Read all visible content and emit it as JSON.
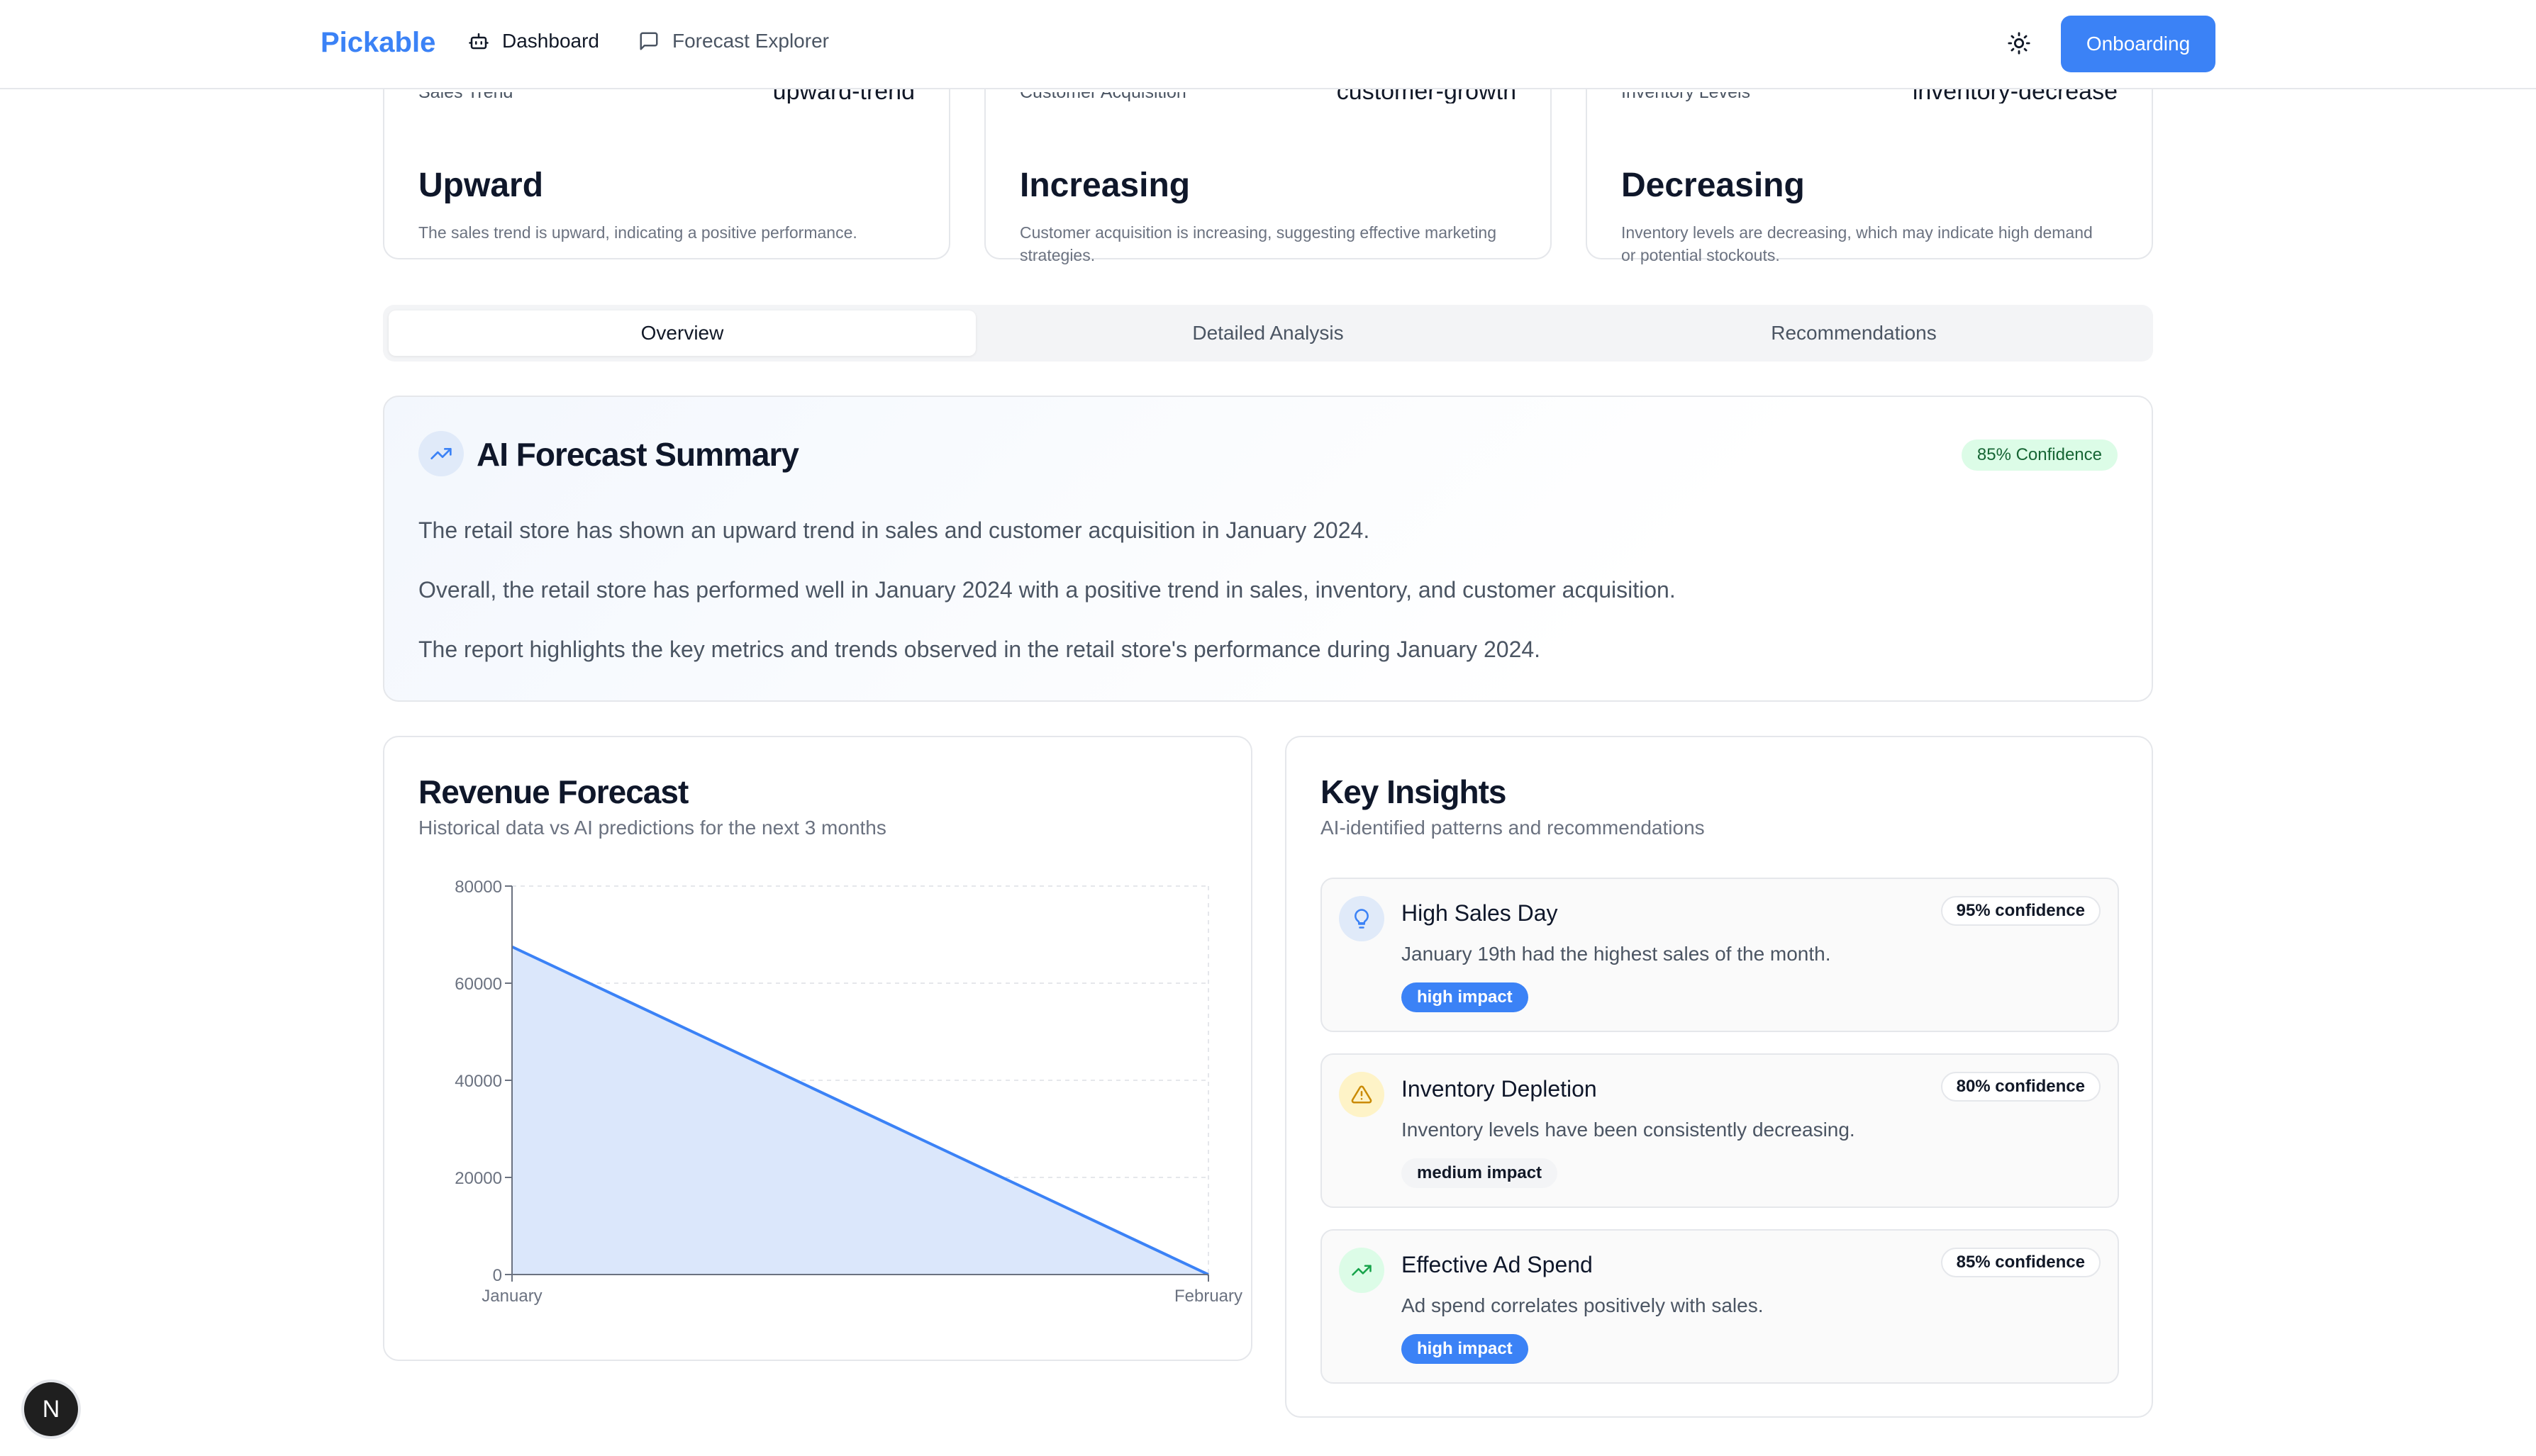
{
  "nav": {
    "brand": "Pickable",
    "links": [
      {
        "label": "Dashboard",
        "icon": "robot-icon",
        "active": true
      },
      {
        "label": "Forecast Explorer",
        "icon": "message-square-icon",
        "active": false
      }
    ],
    "theme_icon": "sun-icon",
    "onboarding_label": "Onboarding"
  },
  "stats": [
    {
      "label": "Sales Trend",
      "key": "upward-trend",
      "value": "Upward",
      "desc": "The sales trend is upward, indicating a positive performance."
    },
    {
      "label": "Customer Acquisition",
      "key": "customer-growth",
      "value": "Increasing",
      "desc": "Customer acquisition is increasing, suggesting effective marketing strategies."
    },
    {
      "label": "Inventory Levels",
      "key": "inventory-decrease",
      "value": "Decreasing",
      "desc": "Inventory levels are decreasing, which may indicate high demand or potential stockouts."
    }
  ],
  "tabs": [
    {
      "label": "Overview",
      "active": true
    },
    {
      "label": "Detailed Analysis",
      "active": false
    },
    {
      "label": "Recommendations",
      "active": false
    }
  ],
  "summary": {
    "icon": "trending-up-icon",
    "title": "AI Forecast Summary",
    "confidence": "85% Confidence",
    "paragraphs": [
      "The retail store has shown an upward trend in sales and customer acquisition in January 2024.",
      "Overall, the retail store has performed well in January 2024 with a positive trend in sales, inventory, and customer acquisition.",
      "The report highlights the key metrics and trends observed in the retail store's performance during January 2024."
    ]
  },
  "revenue": {
    "title": "Revenue Forecast",
    "subtitle": "Historical data vs AI predictions for the next 3 months"
  },
  "chart_data": {
    "type": "area",
    "categories": [
      "January",
      "February"
    ],
    "values": [
      67500,
      0
    ],
    "yticks": [
      "0",
      "20000",
      "40000",
      "60000",
      "80000"
    ],
    "ylim": [
      0,
      80000
    ],
    "grid": true,
    "colors": {
      "line": "#3b82f6",
      "fill": "#dbe7fb",
      "grid": "#e5e7eb"
    }
  },
  "insights": {
    "title": "Key Insights",
    "subtitle": "AI-identified patterns and recommendations",
    "items": [
      {
        "title": "High Sales Day",
        "confidence": "95% confidence",
        "desc": "January 19th had the highest sales of the month.",
        "impact": "high impact",
        "level": "high",
        "icon": "lightbulb-icon",
        "icon_bg": "#e0eaf9",
        "icon_color": "#3b82f6"
      },
      {
        "title": "Inventory Depletion",
        "confidence": "80% confidence",
        "desc": "Inventory levels have been consistently decreasing.",
        "impact": "medium impact",
        "level": "medium",
        "icon": "alert-triangle-icon",
        "icon_bg": "#fef3c7",
        "icon_color": "#ca8a04"
      },
      {
        "title": "Effective Ad Spend",
        "confidence": "85% confidence",
        "desc": "Ad spend correlates positively with sales.",
        "impact": "high impact",
        "level": "high",
        "icon": "trending-up-icon",
        "icon_bg": "#dcfce7",
        "icon_color": "#16a34a"
      }
    ]
  },
  "dev_badge": "N"
}
